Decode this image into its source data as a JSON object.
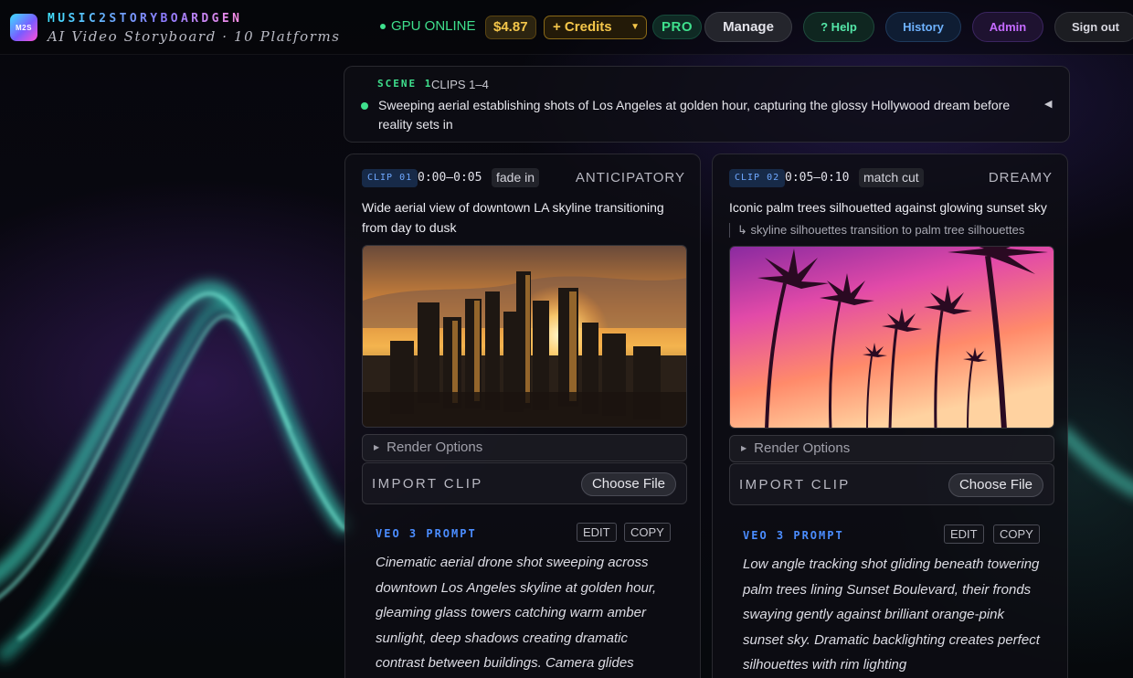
{
  "app": {
    "logo_text": "M2S",
    "title": "MUSIC2STORYBOARDGEN",
    "subtitle": "AI Video Storyboard · 10 Platforms"
  },
  "header": {
    "gpu_status": "GPU ONLINE",
    "balance": "$4.87",
    "credits_label": "+ Credits",
    "plan_badge": "PRO",
    "manage_label": "Manage",
    "help_label": "? Help",
    "history_label": "History",
    "admin_label": "Admin",
    "signout_label": "Sign out"
  },
  "scene": {
    "label": "SCENE 1",
    "clips": "CLIPS 1–4",
    "description": "Sweeping aerial establishing shots of Los Angeles at golden hour, capturing the glossy Hollywood dream before reality sets in"
  },
  "clips": [
    {
      "tag": "CLIP 01",
      "time": "0:00–0:05",
      "transition": "fade in",
      "mood": "ANTICIPATORY",
      "description": "Wide aerial view of downtown LA skyline transitioning from day to dusk",
      "transition_note": "",
      "render_options_label": "Render Options",
      "import_label": "IMPORT CLIP",
      "choose_file_label": "Choose File",
      "prompt_title": "VEO 3 PROMPT",
      "edit_label": "EDIT",
      "copy_label": "COPY",
      "prompt": "Cinematic aerial drone shot sweeping across downtown Los Angeles skyline at golden hour, gleaming glass towers catching warm amber sunlight, deep shadows creating dramatic contrast between buildings. Camera glides"
    },
    {
      "tag": "CLIP 02",
      "time": "0:05–0:10",
      "transition": "match cut",
      "mood": "DREAMY",
      "description": "Iconic palm trees silhouetted against glowing sunset sky",
      "transition_note": "↳ skyline silhouettes transition to palm tree silhouettes",
      "render_options_label": "Render Options",
      "import_label": "IMPORT CLIP",
      "choose_file_label": "Choose File",
      "prompt_title": "VEO 3 PROMPT",
      "edit_label": "EDIT",
      "copy_label": "COPY",
      "prompt": "Low angle tracking shot gliding beneath towering palm trees lining Sunset Boulevard, their fronds swaying gently against brilliant orange-pink sunset sky. Dramatic backlighting creates perfect silhouettes with rim lighting"
    }
  ],
  "colors": {
    "accent_green": "#3fe08d",
    "accent_gold": "#f4c64a",
    "accent_blue": "#4b8dff",
    "accent_purple": "#c56bff"
  }
}
